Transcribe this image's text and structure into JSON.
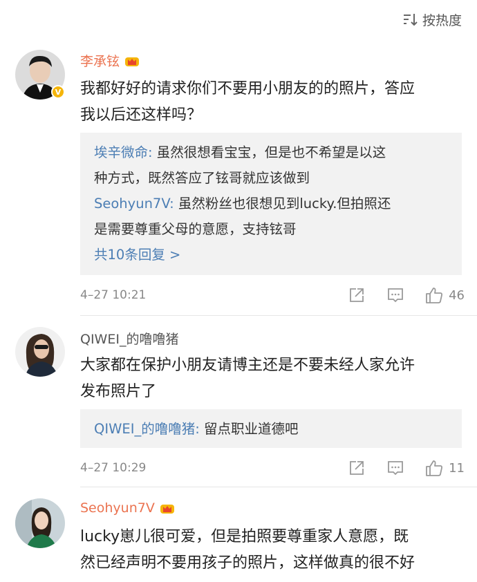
{
  "sort": {
    "label": "按热度",
    "icon": "sort-icon"
  },
  "comments": [
    {
      "username": "李承铉",
      "text_lines": [
        "我都好好的请求你们不要用小朋友的的照片，答应",
        "我以后还这样吗？"
      ],
      "replies": [
        {
          "user": "埃辛微命:",
          "lines": [
            " 虽然很想看宝宝，但是也不希望是以这",
            "种方式，既然答应了铉哥就应该做到"
          ]
        },
        {
          "user": "Seohyun7V:",
          "lines": [
            " 虽然粉丝也很想见到lucky.但拍照还",
            "是需要尊重父母的意愿，支持铉哥"
          ]
        }
      ],
      "more_replies": "共10条回复 >",
      "time": "4–27 10:21",
      "likes": "46"
    },
    {
      "username": "QIWEI_的噜噜猪",
      "text_lines": [
        "大家都在保护小朋友请博主还是不要未经人家允许",
        "发布照片了"
      ],
      "replies": [
        {
          "user": "QIWEI_的噜噜猪:",
          "lines": [
            " 留点职业道德吧"
          ]
        }
      ],
      "time": "4–27 10:29",
      "likes": "11"
    },
    {
      "username": "Seohyun7V",
      "text_lines": [
        "lucky崽儿很可爱，但是拍照要尊重家人意愿，既",
        "然已经声明不要用孩子的照片，这样做真的很不好"
      ]
    }
  ],
  "colors": {
    "username_orange": "#eb7350",
    "reply_blue": "#4c7eb4",
    "reply_bg": "#f2f2f2",
    "verified_gold": "#f5b50a"
  }
}
